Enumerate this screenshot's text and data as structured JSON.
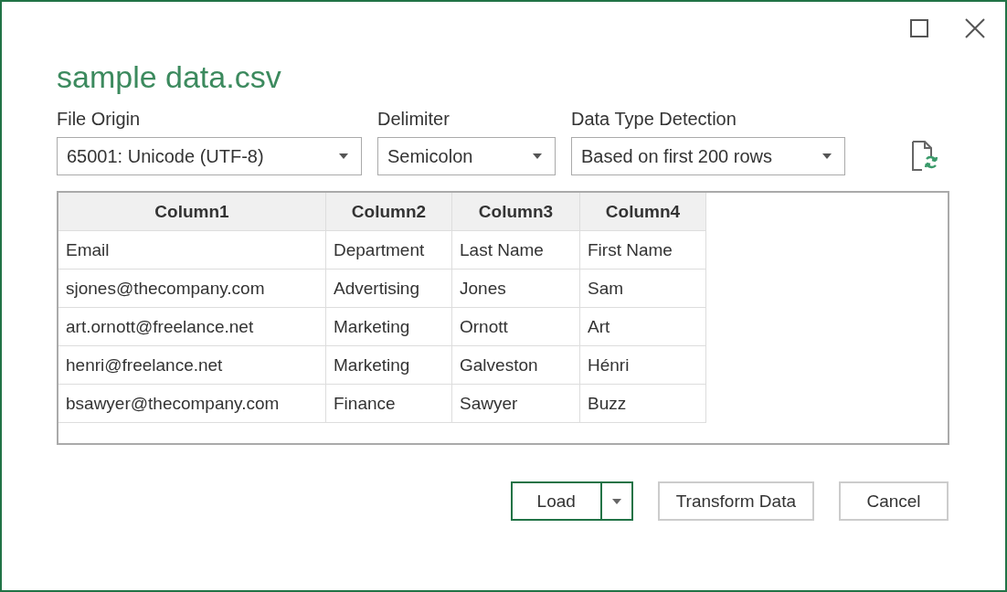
{
  "window": {
    "title": "sample data.csv"
  },
  "options": [
    {
      "label": "File Origin",
      "value": "65001: Unicode (UTF-8)"
    },
    {
      "label": "Delimiter",
      "value": "Semicolon"
    },
    {
      "label": "Data Type Detection",
      "value": "Based on first 200 rows"
    }
  ],
  "table": {
    "columns": [
      "Column1",
      "Column2",
      "Column3",
      "Column4"
    ],
    "rows": [
      [
        "Email",
        "Department",
        "Last Name",
        "First Name"
      ],
      [
        "sjones@thecompany.com",
        "Advertising",
        "Jones",
        "Sam"
      ],
      [
        "art.ornott@freelance.net",
        "Marketing",
        "Ornott",
        "Art"
      ],
      [
        "henri@freelance.net",
        "Marketing",
        "Galveston",
        "Hénri"
      ],
      [
        "bsawyer@thecompany.com",
        "Finance",
        "Sawyer",
        "Buzz"
      ]
    ]
  },
  "buttons": [
    {
      "label": "Load",
      "kind": "split"
    },
    {
      "label": "Transform Data",
      "kind": "plain"
    },
    {
      "label": "Cancel",
      "kind": "plain"
    }
  ]
}
